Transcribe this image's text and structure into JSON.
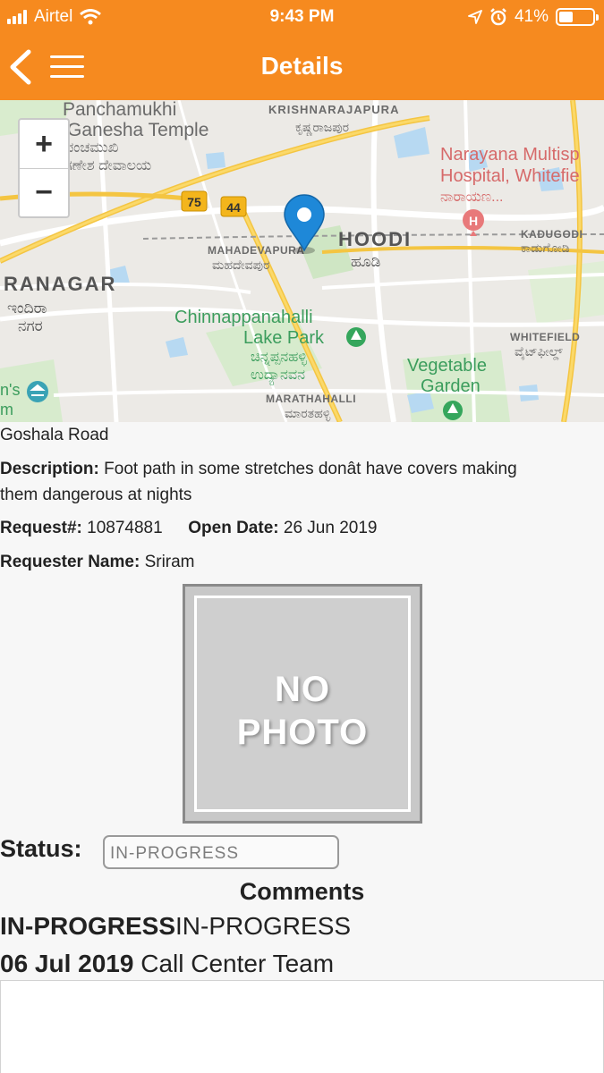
{
  "status_bar": {
    "carrier": "Airtel",
    "time": "9:43 PM",
    "battery": "41%",
    "battery_level": 0.41
  },
  "header": {
    "title": "Details",
    "back_icon": "back-chevron-icon",
    "menu_icon": "hamburger-menu-icon"
  },
  "map": {
    "zoom_in_label": "+",
    "zoom_out_label": "−",
    "labels": {
      "panchamukhi": "Panchamukhi",
      "ganesha": "Ganesha Temple",
      "ganesha_kn1": "ಪಂಚಮುಖಿ",
      "ganesha_kn2": "ಗಣೇಶ ದೇವಾಲಯ",
      "krishnarajapura": "KRISHNARAJAPURA",
      "krishnarajapura_kn": "ಕೃಷ್ಣರಾಜಪುರ",
      "narayana1": "Narayana Multisp",
      "narayana2": "Hospital, Whitefie",
      "narayana_kn": "ನಾರಾಯಣ...",
      "road75": "75",
      "road44": "44",
      "mahadevapura": "MAHADEVAPURA",
      "mahadevapura_kn": "ಮಹದೇವಪುರ",
      "hoodi": "HOODI",
      "hoodi_kn": "ಹೂಡಿ",
      "kadugodi": "KADUGODI",
      "kadugodi_kn": "ಕಾಡುಗೋಡಿ",
      "ranagar": "RANAGAR",
      "ranagar_kn1": "ಇಂದಿರಾ",
      "ranagar_kn2": "ನಗರ",
      "chinnappanahalli": "Chinnappanahalli",
      "lakepark": "Lake Park",
      "lakepark_kn1": "ಚಿನ್ನಪ್ಪನಹಳ್ಳಿ",
      "lakepark_kn2": "ಉದ್ಯಾನವನ",
      "whitefield": "WHITEFIELD",
      "whitefield_kn": "ವೈಟ್‌ಫೀಲ್ಡ್",
      "vegetable": "Vegetable",
      "garden": "Garden",
      "marathahalli": "MARATHAHALLI",
      "marathahalli_kn": "ಮಾರತಹಳ್ಳಿ",
      "edge1": "n's",
      "edge2": "m"
    }
  },
  "details": {
    "address": "Goshala Road",
    "description_label": "Description:",
    "description_line1": "Foot path in some stretches donât have covers making",
    "description_line2": "them dangerous at nights",
    "request_label": "Request#:",
    "request_number": "10874881",
    "open_date_label": "Open Date:",
    "open_date": "26 Jun 2019",
    "requester_label": "Requester Name:",
    "requester_name": "Sriram",
    "photo_line1": "NO",
    "photo_line2": "PHOTO"
  },
  "status": {
    "label": "Status:",
    "value": "IN-PROGRESS"
  },
  "comments": {
    "title": "Comments",
    "entry_status_bold": "IN-PROGRESS",
    "entry_status_text": "IN-PROGRESS",
    "entry_date": "06 Jul 2019",
    "entry_author": "Call Center Team"
  },
  "colors": {
    "brand": "#f68a1f",
    "pin": "#1e88d8"
  }
}
